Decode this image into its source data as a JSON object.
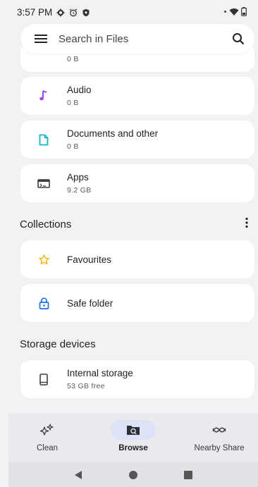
{
  "status_bar": {
    "time": "3:57 PM"
  },
  "search": {
    "placeholder": "Search in Files"
  },
  "partial_card": {
    "size": "0 B"
  },
  "categories": [
    {
      "title": "Audio",
      "size": "0 B"
    },
    {
      "title": "Documents and other",
      "size": "0 B"
    },
    {
      "title": "Apps",
      "size": "9.2 GB"
    }
  ],
  "collections": {
    "heading": "Collections",
    "items": [
      {
        "title": "Favourites"
      },
      {
        "title": "Safe folder"
      }
    ]
  },
  "storage": {
    "heading": "Storage devices",
    "items": [
      {
        "title": "Internal storage",
        "free": "53 GB free"
      }
    ]
  },
  "bottom_nav": [
    {
      "label": "Clean"
    },
    {
      "label": "Browse",
      "active": true
    },
    {
      "label": "Nearby Share"
    }
  ],
  "colors": {
    "audio_icon": "#a142f4",
    "documents_icon": "#12b5cb",
    "favourites_icon": "#f9ab00",
    "safe_folder_icon": "#1a73e8",
    "active_nav_pill": "#dde3f7"
  }
}
